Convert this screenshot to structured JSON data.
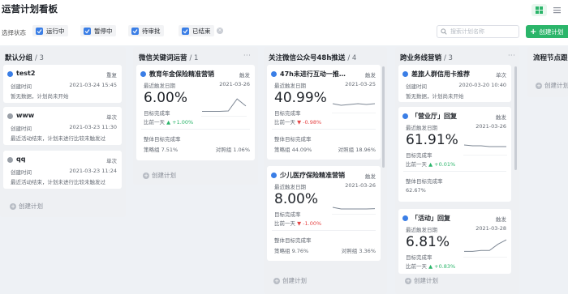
{
  "page": {
    "title": "运营计划看板"
  },
  "filters": {
    "label": "选择状态",
    "chips": [
      {
        "label": "运行中",
        "checked": true
      },
      {
        "label": "暂停中",
        "checked": true
      },
      {
        "label": "待审批",
        "checked": true
      },
      {
        "label": "已结束",
        "checked": true
      }
    ],
    "clear_icon": "×"
  },
  "search": {
    "placeholder": "搜索计划名称"
  },
  "create_button": {
    "label": "创建计划",
    "icon": "+"
  },
  "colors": {
    "accent": "#2bb56a",
    "running": "#3a7ee6",
    "up": "#2bb56a",
    "down": "#e54545"
  },
  "add_plan_label": "创建计划",
  "columns": [
    {
      "name": "默认分组",
      "count": "/ 3",
      "cards": [
        {
          "name": "test2",
          "status": "running",
          "tag": "重复",
          "time_label": "创建时间",
          "time": "2021-03-24 15:45",
          "note": "暂无数据，计划尚未开始"
        },
        {
          "name": "www",
          "status": "paused",
          "tag": "单次",
          "time_label": "创建时间",
          "time": "2021-03-23 11:30",
          "note": "最近活动结束，计划未进行比较未触发过"
        },
        {
          "name": "qq",
          "status": "paused",
          "tag": "单次",
          "time_label": "创建时间",
          "time": "2021-03-23 11:24",
          "note": "最近活动结束，计划未进行比较未触发过"
        }
      ]
    },
    {
      "name": "微信关键词运营",
      "count": "/ 1",
      "cards": [
        {
          "name": "教育年金保险精准营销",
          "tag": "触发",
          "date_label": "最近触发日期",
          "date": "2021-03-26",
          "value": "6.00%",
          "metric": "目标完成率",
          "cmp_label": "比前一天",
          "cmp": "▲ +1.00%",
          "trend": "up",
          "overall_label": "整体目标完成率",
          "policy": "策略组 7.51%",
          "control": "对照组 1.06%",
          "spark": [
            0.25,
            0.25,
            0.25,
            0.27,
            0.95,
            0.55
          ]
        }
      ]
    },
    {
      "name": "关注微信公众号48h推送",
      "count": "/ 4",
      "cards": [
        {
          "name": "47h未进行互动一推…",
          "tag": "触发",
          "date_label": "最近触发日期",
          "date": "2021-03-25",
          "value": "40.99%",
          "metric": "目标完成率",
          "cmp_label": "比前一天",
          "cmp": "▼ -0.98%",
          "trend": "down",
          "overall_label": "整体目标完成率",
          "policy": "策略组 44.09%",
          "control": "对照组 18.96%",
          "spark": [
            0.55,
            0.45,
            0.5,
            0.55,
            0.5,
            0.55
          ]
        },
        {
          "name": "少儿医疗保险精准营销",
          "tag": "触发",
          "date_label": "最近触发日期",
          "date": "2021-03-26",
          "value": "8.00%",
          "metric": "目标完成率",
          "cmp_label": "比前一天",
          "cmp": "▼ -1.00%",
          "trend": "down",
          "overall_label": "整体目标完成率",
          "policy": "策略组 9.76%",
          "control": "对照组 3.36%",
          "spark": [
            0.4,
            0.3,
            0.3,
            0.3,
            0.3,
            0.32
          ]
        }
      ]
    },
    {
      "name": "跨业务线营销",
      "count": "/ 3",
      "cards": [
        {
          "name": "差旅人群信用卡推荐",
          "status": "running",
          "tag": "单次",
          "time_label": "创建时间",
          "time": "2020-03-20 10:40",
          "note": "暂无数据，计划尚未开始"
        },
        {
          "name": "「营业厅」回复",
          "tag": "触发",
          "date_label": "最近触发日期",
          "date": "2021-03-26",
          "value": "61.91%",
          "metric": "目标完成率",
          "cmp_label": "比前一天",
          "cmp": "▲ +0.01%",
          "trend": "up",
          "overall_label": "整体目标完成率",
          "overall": "62.67%",
          "spark": [
            0.6,
            0.55,
            0.55,
            0.5,
            0.5,
            0.5
          ]
        },
        {
          "name": "「活动」回复",
          "tag": "触发",
          "date_label": "最近触发日期",
          "date": "2021-03-28",
          "value": "6.81%",
          "metric": "目标完成率",
          "cmp_label": "比前一天",
          "cmp": "▲ +0.83%",
          "trend": "up",
          "overall_label": "",
          "spark": [
            0.3,
            0.3,
            0.35,
            0.35,
            0.7,
            0.95
          ]
        }
      ]
    },
    {
      "name": "流程节点跟",
      "count": "",
      "cards": []
    }
  ]
}
